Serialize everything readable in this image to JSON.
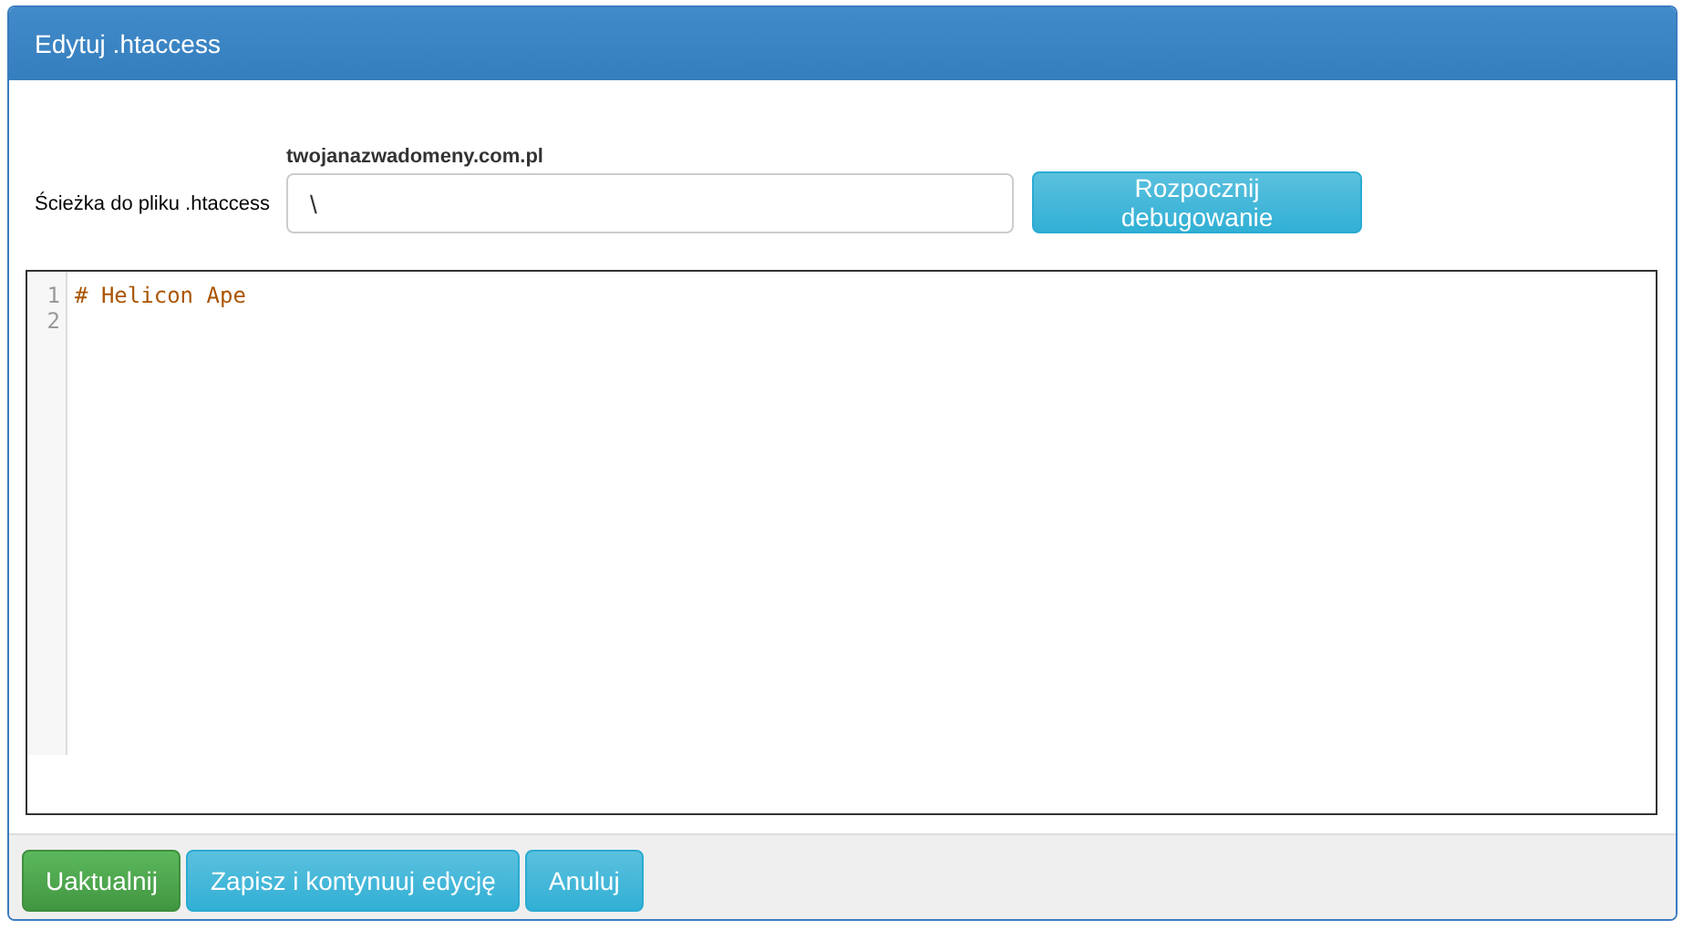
{
  "window": {
    "title": "Edytuj .htaccess"
  },
  "path": {
    "label": "Ścieżka do pliku .htaccess",
    "domain": "twojanazwadomeny.com.pl",
    "value": "\\",
    "button": "Rozpocznij debugowanie"
  },
  "editor": {
    "lines": [
      {
        "number": "1",
        "text": "# Helicon Ape",
        "kind": "comment"
      },
      {
        "number": "2"
      }
    ]
  },
  "buttons": [
    {
      "label": "Uaktualnij",
      "kind": "success"
    },
    {
      "label": "Zapisz i kontynuuj edycję",
      "kind": "info"
    },
    {
      "label": "Anuluj",
      "kind": "info"
    }
  ]
}
